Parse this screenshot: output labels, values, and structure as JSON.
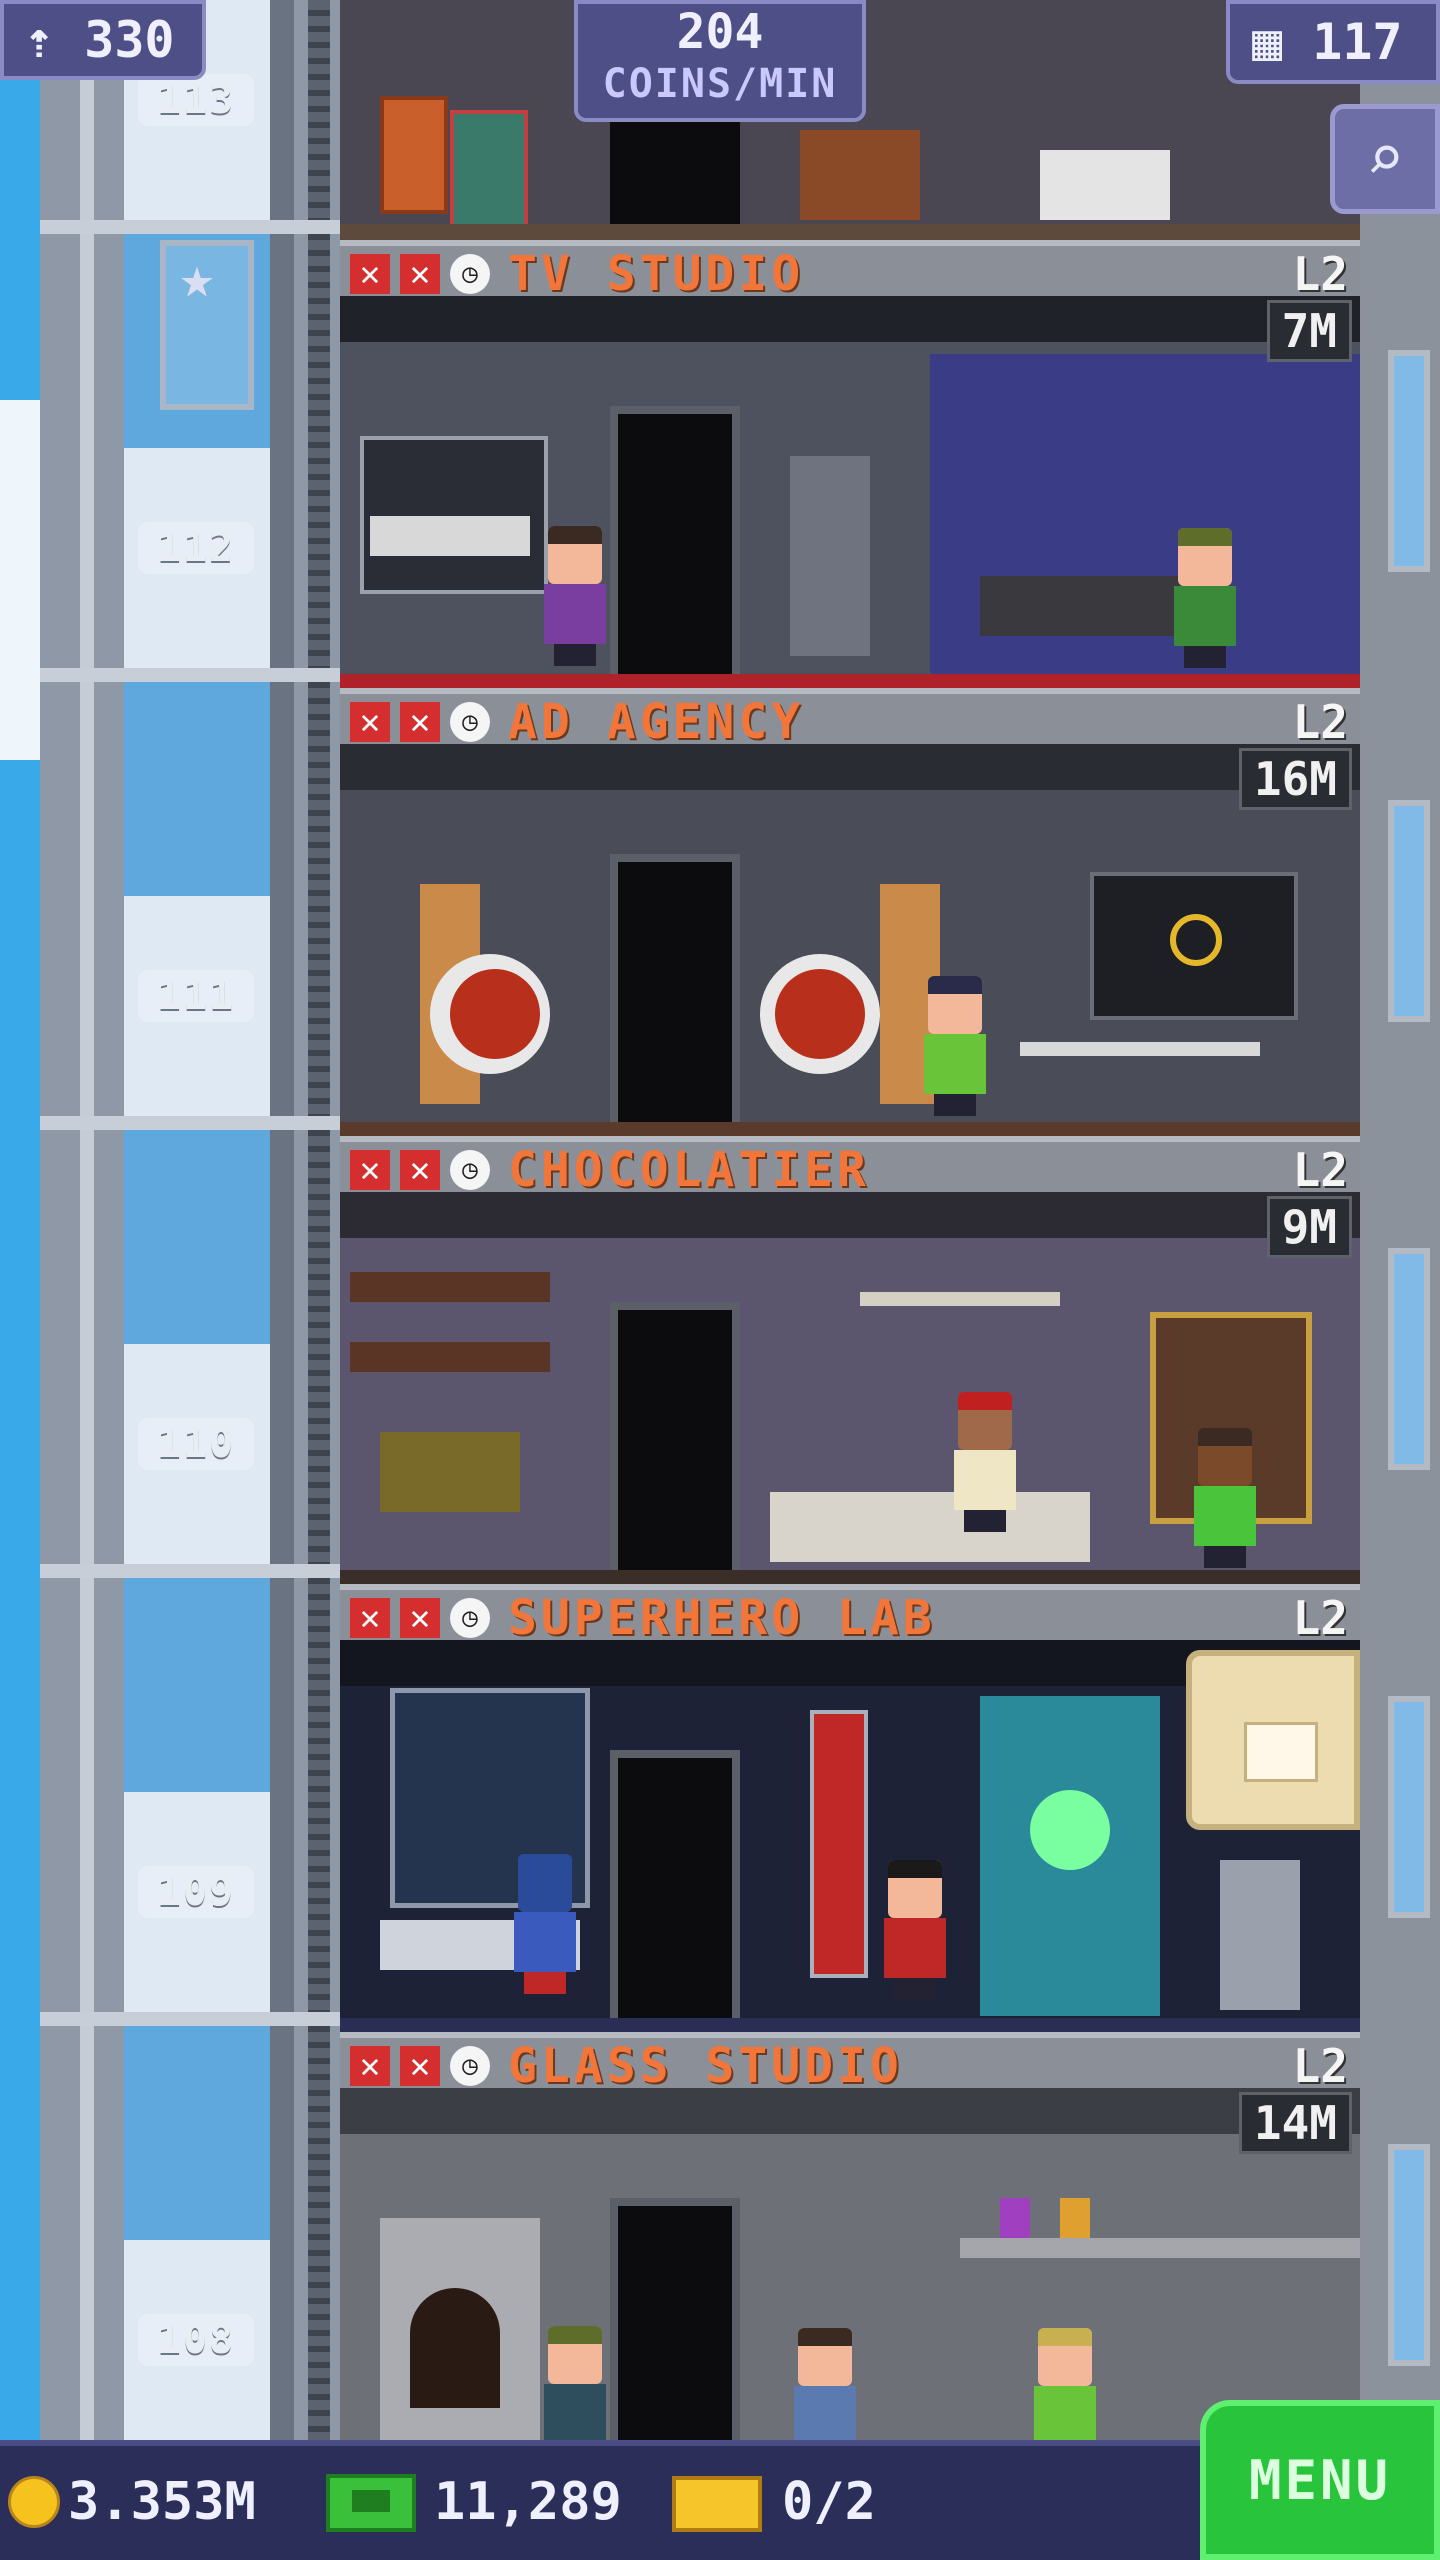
{
  "hud": {
    "population": "330",
    "coins_per_min_value": "204",
    "coins_per_min_unit": "COINS/MIN",
    "floors_count": "117"
  },
  "elevator": {
    "floor_labels": [
      "113",
      "112",
      "111",
      "110",
      "109",
      "108"
    ]
  },
  "floors": [
    {
      "name": "TV STUDIO",
      "level": "L2",
      "timer": "7M"
    },
    {
      "name": "AD AGENCY",
      "level": "L2",
      "timer": "16M"
    },
    {
      "name": "CHOCOLATIER",
      "level": "L2",
      "timer": "9M"
    },
    {
      "name": "SUPERHERO LAB",
      "level": "L2",
      "timer": ""
    },
    {
      "name": "GLASS STUDIO",
      "level": "L2",
      "timer": "14M"
    }
  ],
  "bottom_bar": {
    "coins": "3.353M",
    "bux": "11,289",
    "tickets": "0/2",
    "menu_label": "MENU"
  },
  "colors": {
    "floor_name": "#f2753a",
    "menu_button": "#28c43c",
    "hud_panel": "#4f4f87",
    "restock_flag": "#d42e2e"
  },
  "icons": {
    "population": "person-up-icon",
    "floors": "building-icon",
    "zoom": "magnifier-icon",
    "coin": "coin-icon",
    "bux": "bux-icon",
    "ticket": "ticket-icon",
    "restock": "x-icon",
    "clock": "clock-icon",
    "build": "crate-icon",
    "vip": "star-icon"
  }
}
